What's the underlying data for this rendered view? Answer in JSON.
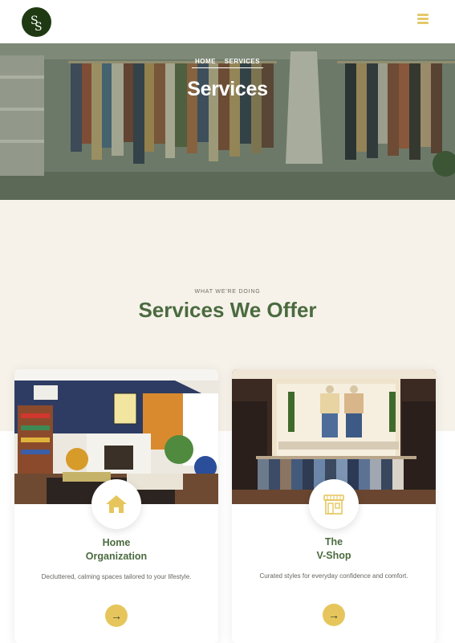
{
  "header": {
    "logo_icon": "ss-monogram-logo",
    "menu_icon": "hamburger-menu-icon",
    "brand_color": "#1f3a12",
    "accent_color": "#e3c96a"
  },
  "hero": {
    "breadcrumb": [
      "HOME",
      "SERVICES"
    ],
    "title": "Services"
  },
  "section": {
    "eyebrow": "WHAT WE'RE DOING",
    "title": "Services We Offer"
  },
  "cards": [
    {
      "title_lines": [
        "Home",
        "Organization"
      ],
      "description": "Decluttered, calming spaces tailored to your lifestyle.",
      "icon": "house-icon",
      "button_icon": "arrow-right-icon"
    },
    {
      "title_lines": [
        "The",
        "V-Shop"
      ],
      "description": "Curated styles for everyday confidence and comfort.",
      "icon": "storefront-icon",
      "button_icon": "arrow-right-icon"
    }
  ]
}
